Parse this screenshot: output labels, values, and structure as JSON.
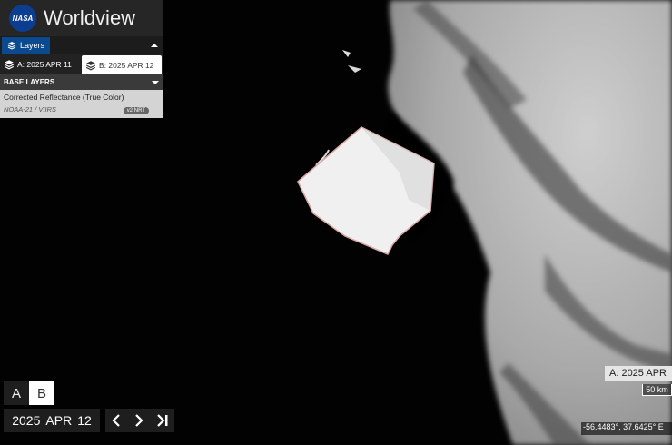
{
  "app": {
    "logo_text": "NASA",
    "title": "Worldview"
  },
  "layers_tab": {
    "label": "Layers",
    "icon": "layers-icon"
  },
  "compare": {
    "a_label": "A: 2025  APR  11",
    "b_label": "B: 2025  APR  12"
  },
  "base_layers": {
    "header": "BASE LAYERS",
    "layer": {
      "title": "Corrected Reflectance (True Color)",
      "subtitle": "NOAA-21 / VIIRS",
      "badge": "v2 NRT"
    }
  },
  "ab_toggle": {
    "a": "A",
    "b": "B",
    "selected": "B"
  },
  "date": {
    "year": "2025",
    "month": "APR",
    "day": "12"
  },
  "map_overlay": {
    "date_label": "A:  2025  APR",
    "scale": "50 km",
    "coords": "-56.4483°, 37.6425°  E"
  },
  "colors": {
    "accent": "#0b4a8f",
    "panel": "#1e1e1e",
    "iceberg": "#f0f0f0"
  }
}
